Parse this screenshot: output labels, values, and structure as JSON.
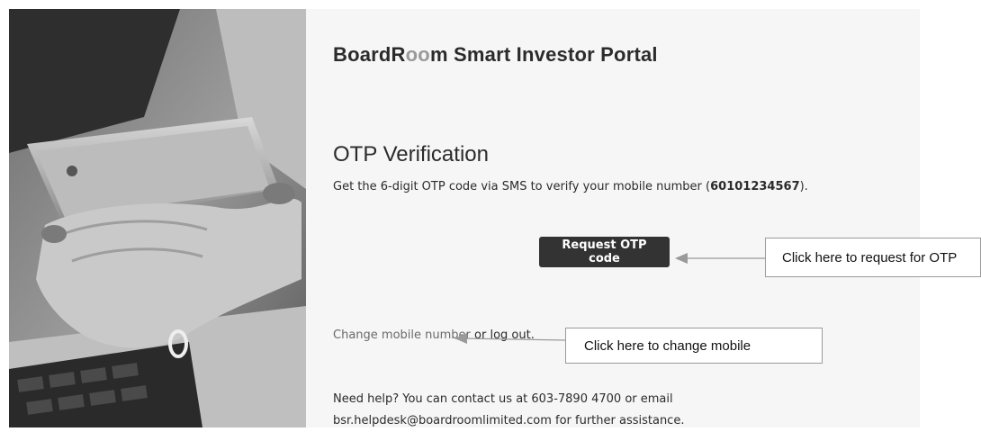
{
  "header": {
    "brand_part1": "BoardR",
    "brand_oo": "oo",
    "brand_part2": "m Smart Investor Portal"
  },
  "verification": {
    "title": "OTP Verification",
    "instruction_prefix": "Get the 6-digit OTP code via SMS to verify your mobile number (",
    "mobile_number": "60101234567",
    "instruction_suffix": ")."
  },
  "actions": {
    "request_otp_label": "Request OTP code",
    "change_mobile_label": "Change mobile number",
    "or_text": " or ",
    "logout_label": "log out",
    "period": "."
  },
  "help": {
    "line1": "Need help? You can contact us at 603-7890 4700 or email",
    "email": "bsr.helpdesk@boardroomlimited.com",
    "line2_suffix": " for further assistance."
  },
  "annotations": {
    "request_otp_callout": "Click here to request for OTP",
    "change_mobile_callout": "Click here to change mobile"
  },
  "colors": {
    "button_bg": "#333333",
    "panel_bg": "#f6f6f6",
    "callout_border": "#9a9a9a"
  }
}
